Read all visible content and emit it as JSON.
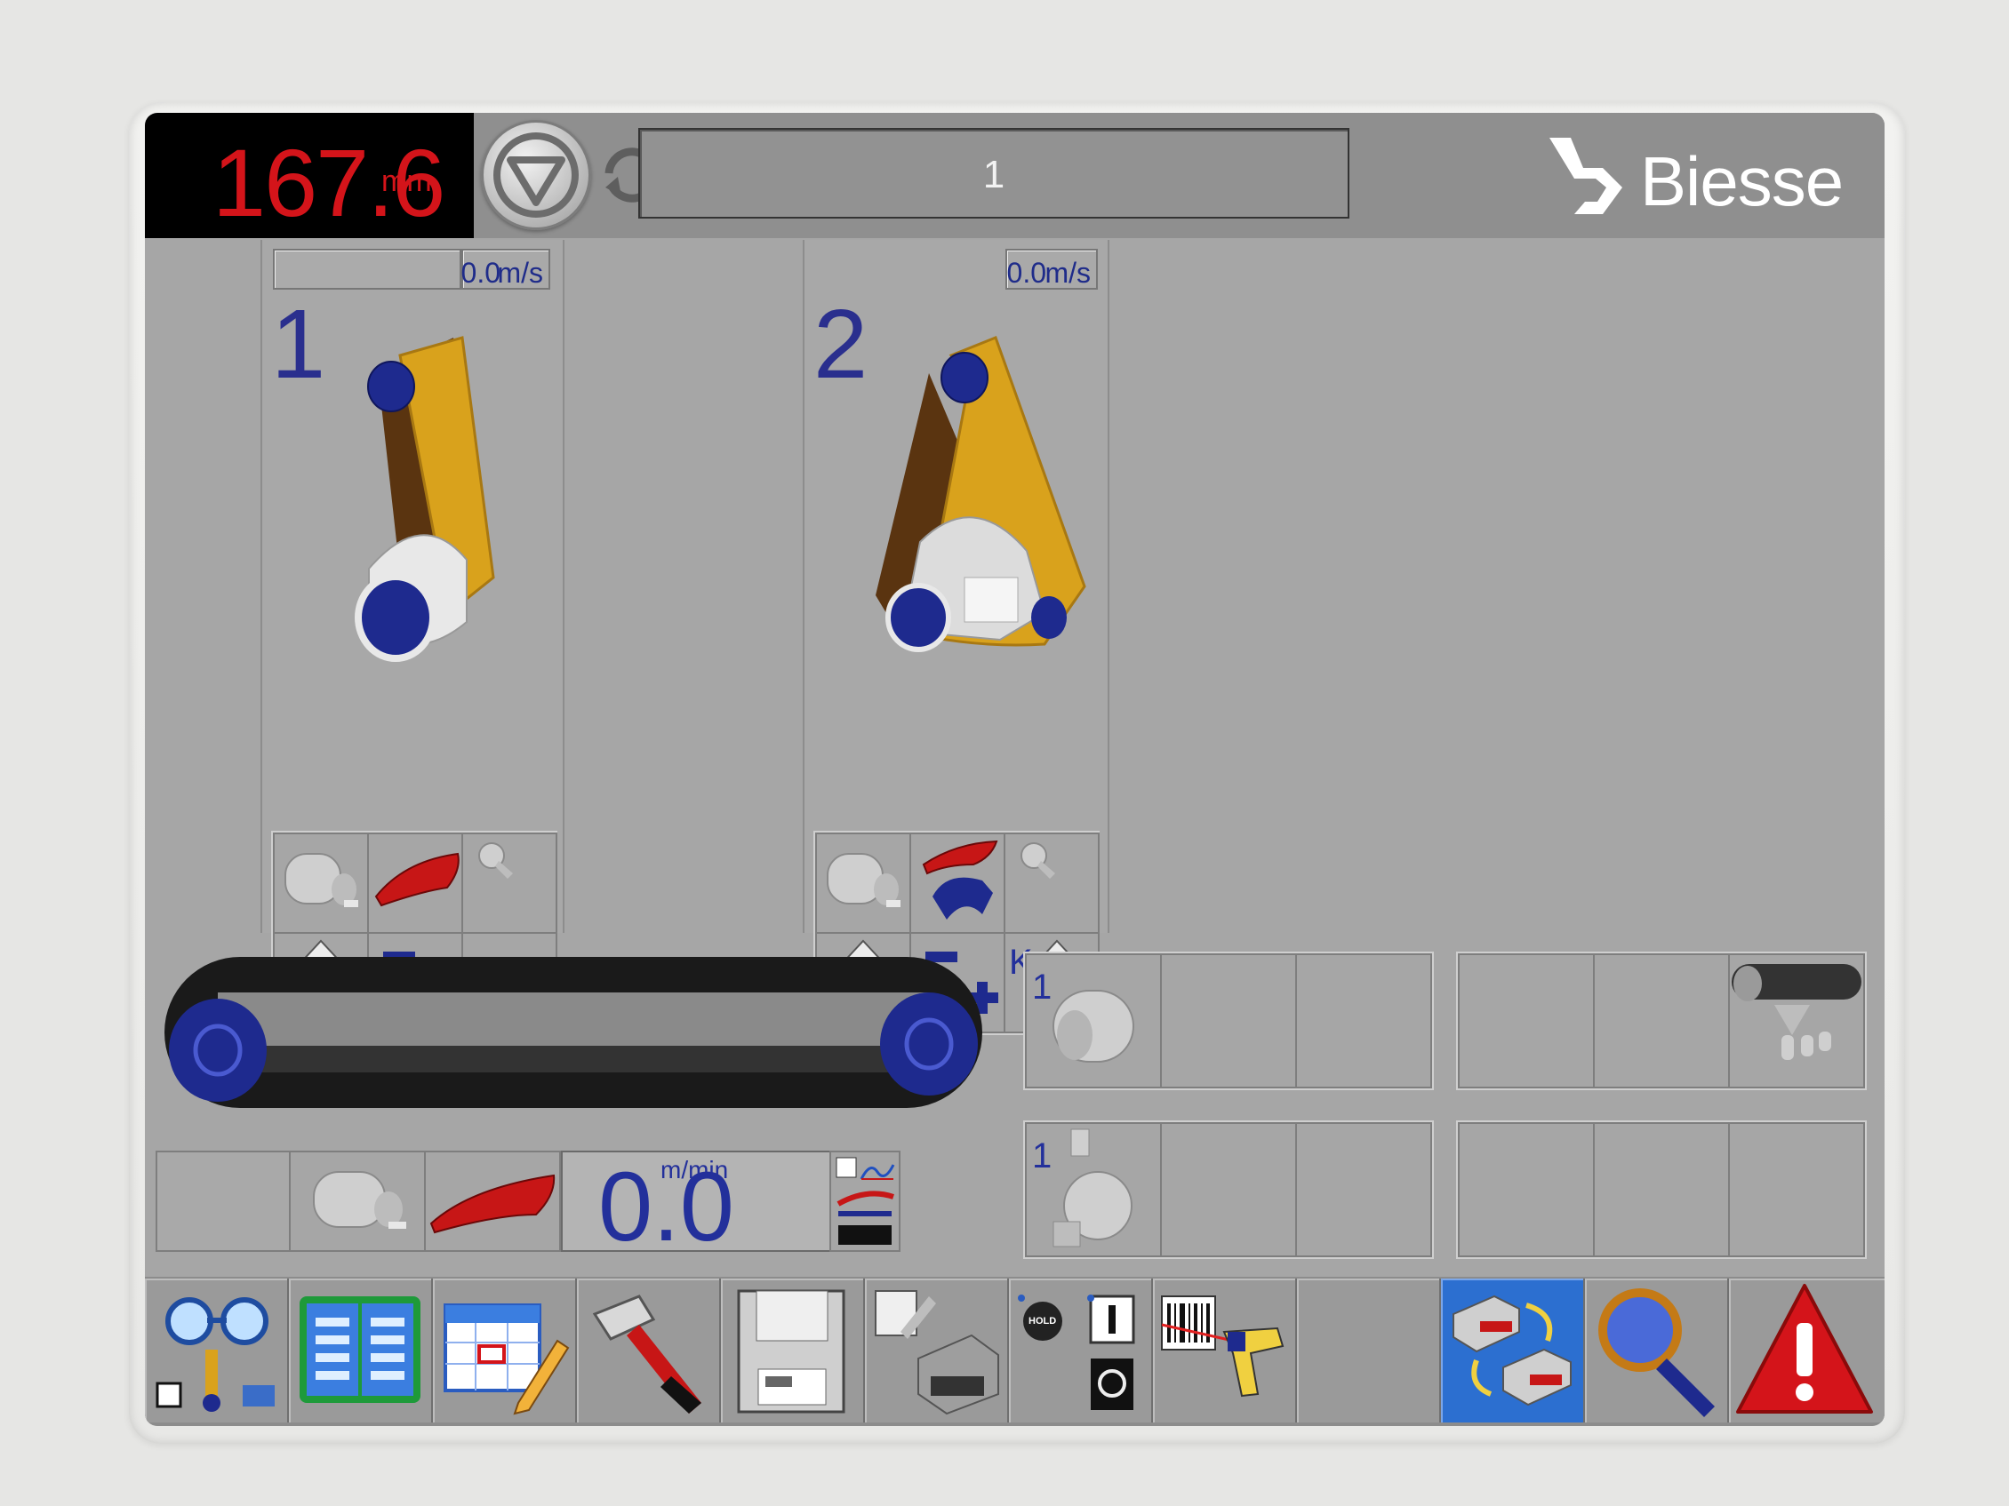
{
  "header": {
    "counter_value": "167.6",
    "counter_unit": "mm",
    "message": "1",
    "brand": "Biesse"
  },
  "units": [
    {
      "number": "1",
      "speed_value": "0.0",
      "speed_unit": "m/s"
    },
    {
      "number": "2",
      "speed_value": "0.0",
      "speed_unit": "m/s"
    }
  ],
  "right_grids": {
    "group_a_label": "1",
    "group_b_label": "1"
  },
  "conveyor": {
    "feed_speed_value": "0.0",
    "feed_speed_unit": "m/min"
  },
  "grid_labels": {
    "k_label": "K"
  },
  "toolbar_hold_label": "HOLD",
  "colors": {
    "accent_blue": "#23309b",
    "counter_red": "#d4141a",
    "belt_yellow": "#e0a81a",
    "roller_blue": "#1e2a8e",
    "active_tool": "#2c6fd0"
  },
  "icons": [
    "stop-icon",
    "refresh-icon",
    "biesse-logo",
    "motor-icon",
    "shoe-icon",
    "nozzle-icon",
    "lift-icon",
    "offset-plus-icon",
    "k-lift-icon",
    "roller-icon",
    "blower-icon",
    "brush-icon",
    "glasses-icon",
    "manual-icon",
    "calendar-icon",
    "hammer-icon",
    "floppy-icon",
    "machine-edit-icon",
    "hold-icon",
    "on-off-icon",
    "barcode-scanner-icon",
    "swap-machine-icon",
    "magnifier-icon",
    "warning-icon"
  ]
}
